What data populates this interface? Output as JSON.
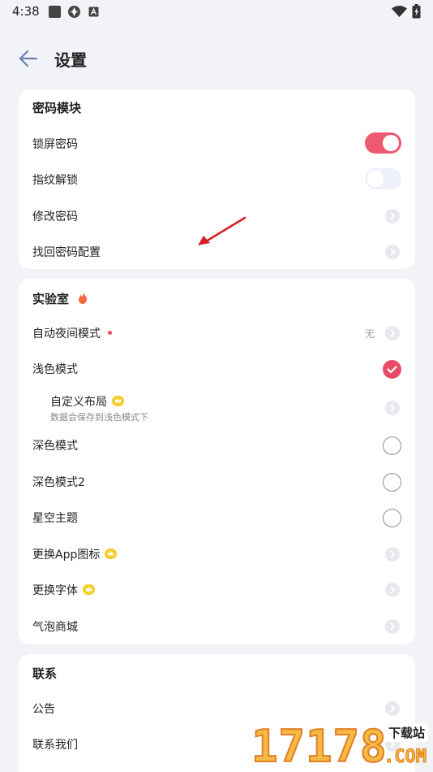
{
  "status_bar": {
    "time": "4:38"
  },
  "header": {
    "title": "设置"
  },
  "sections": {
    "password": {
      "title": "密码模块",
      "items": [
        {
          "label": "锁屏密码",
          "control": "toggle",
          "on": true
        },
        {
          "label": "指纹解锁",
          "control": "toggle",
          "on": false
        },
        {
          "label": "修改密码",
          "control": "chevron"
        },
        {
          "label": "找回密码配置",
          "control": "chevron"
        }
      ]
    },
    "lab": {
      "title": "实验室",
      "items": [
        {
          "label": "自动夜间模式",
          "value": "无",
          "badge": "red-dot"
        },
        {
          "label": "浅色模式",
          "control": "radio",
          "checked": true
        },
        {
          "label": "自定义布局",
          "desc": "数据会保存到浅色模式下",
          "badge": "crown"
        },
        {
          "label": "深色模式",
          "control": "radio",
          "checked": false
        },
        {
          "label": "深色模式2",
          "control": "radio",
          "checked": false
        },
        {
          "label": "星空主题",
          "control": "radio",
          "checked": false
        },
        {
          "label": "更换App图标",
          "badge": "crown"
        },
        {
          "label": "更换字体",
          "badge": "crown"
        },
        {
          "label": "气泡商城"
        }
      ]
    },
    "contact": {
      "title": "联系",
      "items": [
        {
          "label": "公告"
        },
        {
          "label": "联系我们"
        }
      ]
    }
  },
  "watermark": {
    "digits": "17178",
    "tag": "下载站",
    "suffix": ".COM"
  },
  "colors": {
    "accent": "#ea4b66",
    "background": "#f2f3f7",
    "card": "#ffffff",
    "annotation_arrow": "#d42020",
    "crown": "#f7cc2e"
  }
}
